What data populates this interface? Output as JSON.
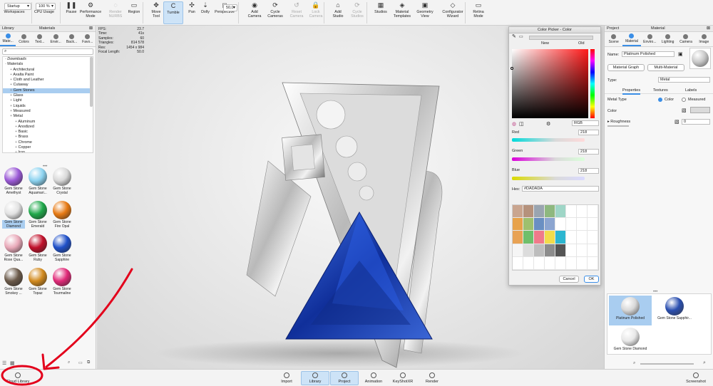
{
  "toolbar": {
    "startup": "Startup",
    "zoom": "100 %",
    "items": [
      {
        "label": "Workspaces",
        "icon": "workspaces-icon"
      },
      {
        "label": "CPU Usage",
        "icon": "cpu-icon"
      },
      {
        "label": "Pause",
        "icon": "pause-icon"
      },
      {
        "label": "Performance\nMode",
        "icon": "performance-icon"
      },
      {
        "label": "Render\nNURBS",
        "icon": "nurbs-icon"
      },
      {
        "label": "Region",
        "icon": "region-icon"
      },
      {
        "label": "Move\nTool",
        "icon": "move-tool-icon"
      },
      {
        "label": "Tumble",
        "icon": "tumble-icon"
      },
      {
        "label": "Pan",
        "icon": "pan-icon"
      },
      {
        "label": "Dolly",
        "icon": "dolly-icon"
      },
      {
        "label": "Perspective",
        "icon": "perspective-icon"
      },
      {
        "label": "Add\nCamera",
        "icon": "add-camera-icon"
      },
      {
        "label": "Cycle\nCameras",
        "icon": "cycle-cameras-icon"
      },
      {
        "label": "Reset\nCamera",
        "icon": "reset-camera-icon"
      },
      {
        "label": "Lock\nCamera",
        "icon": "lock-camera-icon"
      },
      {
        "label": "Add\nStudio",
        "icon": "add-studio-icon"
      },
      {
        "label": "Cycle\nStudios",
        "icon": "cycle-studios-icon"
      },
      {
        "label": "Studios",
        "icon": "studios-icon"
      },
      {
        "label": "Material\nTemplates",
        "icon": "material-templates-icon"
      },
      {
        "label": "Geometry\nView",
        "icon": "geometry-view-icon"
      },
      {
        "label": "Configurator\nWizard",
        "icon": "configurator-icon"
      },
      {
        "label": "Retina\nMode",
        "icon": "retina-icon"
      }
    ],
    "perspective_value": "50,0"
  },
  "left": {
    "tab_library": "Library",
    "tab_materials": "Materials",
    "tabs": [
      "Mate...",
      "Colors",
      "Text...",
      "Envir...",
      "Back...",
      "Favo..."
    ],
    "tree": [
      {
        "label": "Downloads",
        "indent": 0,
        "italic": true
      },
      {
        "label": "Materials",
        "indent": 0
      },
      {
        "label": "Architectural",
        "indent": 1
      },
      {
        "label": "Axalta Paint",
        "indent": 1
      },
      {
        "label": "Cloth and Leather",
        "indent": 1
      },
      {
        "label": "Cutaway",
        "indent": 1
      },
      {
        "label": "Gem Stones",
        "indent": 1,
        "selected": true
      },
      {
        "label": "Glass",
        "indent": 1
      },
      {
        "label": "Light",
        "indent": 1
      },
      {
        "label": "Liquids",
        "indent": 1
      },
      {
        "label": "Measured",
        "indent": 1
      },
      {
        "label": "Metal",
        "indent": 1
      },
      {
        "label": "Aluminum",
        "indent": 2
      },
      {
        "label": "Anodized",
        "indent": 2
      },
      {
        "label": "Basic",
        "indent": 2
      },
      {
        "label": "Brass",
        "indent": 2
      },
      {
        "label": "Chrome",
        "indent": 2
      },
      {
        "label": "Copper",
        "indent": 2
      },
      {
        "label": "Iron",
        "indent": 2
      }
    ],
    "materials": [
      {
        "label": "Gem Stone\nAmethyst",
        "color": "#9b5ad6"
      },
      {
        "label": "Gem Stone\nAquamari...",
        "color": "#8cd3f0"
      },
      {
        "label": "Gem Stone\nCrystal",
        "color": "#d8d8d8"
      },
      {
        "label": "Gem Stone\nDiamond",
        "color": "#e2e2e2",
        "selected": true
      },
      {
        "label": "Gem Stone\nEmerald",
        "color": "#1fa84a"
      },
      {
        "label": "Gem Stone\nFire Opal",
        "color": "#e77a14"
      },
      {
        "label": "Gem Stone\nRose Qua...",
        "color": "#e8a8b8"
      },
      {
        "label": "Gem Stone\nRuby",
        "color": "#c0102a"
      },
      {
        "label": "Gem Stone\nSapphire",
        "color": "#1f50c8"
      },
      {
        "label": "Gem Stone\nSmokey ...",
        "color": "#6b5a4a"
      },
      {
        "label": "Gem Stone\nTopaz",
        "color": "#d28a1e"
      },
      {
        "label": "Gem Stone\nTourmaline",
        "color": "#e02a78"
      }
    ]
  },
  "stats": [
    {
      "k": "FPS:",
      "v": "23.7"
    },
    {
      "k": "Time:",
      "v": "41s"
    },
    {
      "k": "Samples:",
      "v": "60"
    },
    {
      "k": "Triangles:",
      "v": "814 578"
    },
    {
      "k": "Res:",
      "v": "1454 x 984"
    },
    {
      "k": "Focal Length:",
      "v": "50.0"
    }
  ],
  "picker": {
    "title": "Color Picker - Color",
    "new_label": "New",
    "old_label": "Old",
    "mode": "RGB",
    "red_label": "Red",
    "red": "218",
    "green_label": "Green",
    "green": "218",
    "blue_label": "Blue",
    "blue": "218",
    "hex_label": "Hex:",
    "hex": "#DADADA",
    "cancel": "Cancel",
    "ok": "OK",
    "swatches": [
      "#c9a58f",
      "#b5927c",
      "#9aa5b0",
      "#8eb87f",
      "#9fd6c7",
      "#fff",
      "#fff",
      "#fff",
      "#e7a24a",
      "#9ec06e",
      "#6a8fc2",
      "#8ca5d0",
      "#ffffff",
      "#fff",
      "#fff",
      "#fff",
      "#e8a254",
      "#6fbf6b",
      "#f07a8a",
      "#f2dc4a",
      "#2cb6d0",
      "#fff",
      "#fff",
      "#fff",
      "#f5f5f5",
      "#dcdcdc",
      "#bdbdbd",
      "#8c8c8c",
      "#555555",
      "#fff",
      "#fff",
      "#fff",
      "#fff",
      "#fff",
      "#fff",
      "#fff",
      "#fff",
      "#fff",
      "#fff",
      "#fff"
    ]
  },
  "right": {
    "tab_project": "Project",
    "tab_material": "Material",
    "tabs": [
      "Scene",
      "Material",
      "Enviro...",
      "Lighting",
      "Camera",
      "Image"
    ],
    "name_label": "Name:",
    "name": "Platinum Polished",
    "material_graph": "Material Graph",
    "multi_material": "Multi-Material",
    "type_label": "Type:",
    "type": "Metal",
    "subtabs": [
      "Properties",
      "Textures",
      "Labels"
    ],
    "metal_type": "Metal Type",
    "opt_color": "Color",
    "opt_measured": "Measured",
    "color_label": "Color",
    "roughness_label": "Roughness",
    "roughness": "0",
    "thumbs": [
      {
        "label": "Platinum Polished",
        "color": "#d8d8d8",
        "selected": true
      },
      {
        "label": "Gem Stone Sapphir...",
        "color": "#2a4fb0"
      },
      {
        "label": "Gem Stone Diamond",
        "color": "#e8e8e8"
      }
    ]
  },
  "bottom": {
    "cloud_library": "Cloud Library",
    "import": "Import",
    "library": "Library",
    "project": "Project",
    "animation": "Animation",
    "keyshotxr": "KeyShotXR",
    "render": "Render",
    "screenshot": "Screenshot"
  },
  "annotation_color": "#e3001b"
}
